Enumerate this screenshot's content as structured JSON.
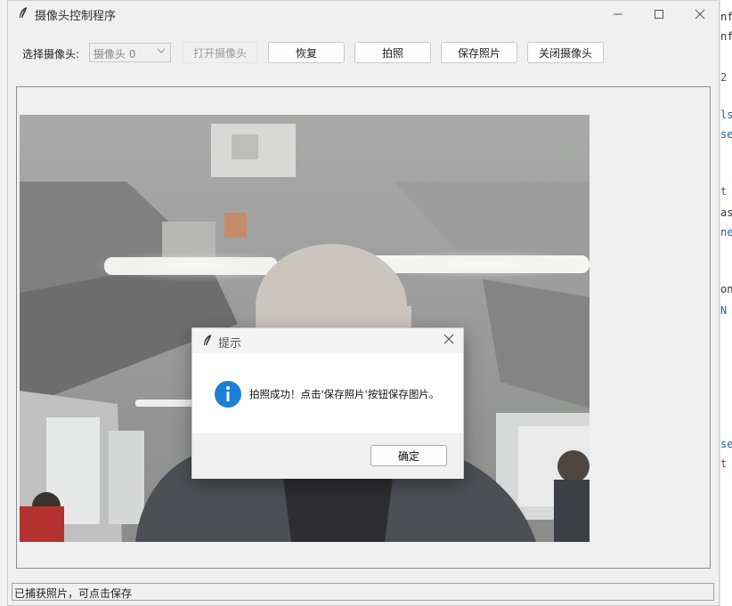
{
  "window": {
    "title": "摄像头控制程序",
    "controls": [
      "minimize-icon",
      "maximize-icon",
      "close-icon"
    ]
  },
  "toolbar": {
    "camera_label": "选择摄像头:",
    "camera_select_value": "摄像头 0",
    "open_button": "打开摄像头",
    "restore_button": "恢复",
    "capture_button": "拍照",
    "save_button": "保存照片",
    "close_camera_button": "关闭摄像头"
  },
  "status": {
    "text": "已捕获照片，可点击保存"
  },
  "dialog": {
    "title": "提示",
    "message": "拍照成功！点击'保存照片'按钮保存图片。",
    "ok_button": "确定"
  },
  "background_editor": {
    "lines": [
      "nf",
      "nf",
      "2",
      "ls",
      "se",
      "t",
      "as",
      "ne",
      "on",
      "N",
      "se",
      "t"
    ]
  },
  "colors": {
    "window_bg": "#f0f0f0",
    "info_blue": "#1a7fd6",
    "button_bg": "#fdfdfd"
  }
}
